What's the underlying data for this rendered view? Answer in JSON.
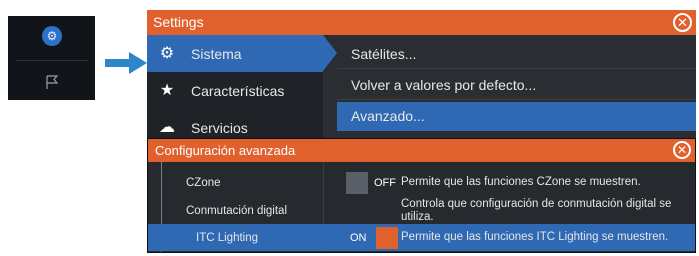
{
  "colors": {
    "accent": "#e0612d",
    "selection": "#2f69b3",
    "panel": "#2a2d31"
  },
  "device": {
    "icons": [
      "gear-icon",
      "flag-icon"
    ]
  },
  "settings": {
    "title": "Settings",
    "menu": [
      {
        "label": "Sistema",
        "icon": "gear-icon"
      },
      {
        "label": "Características",
        "icon": "star-icon"
      },
      {
        "label": "Servicios",
        "icon": "cloud-icon"
      }
    ],
    "options": [
      "Satélites...",
      "Volver a valores por defecto...",
      "Avanzado..."
    ]
  },
  "advanced": {
    "title": "Configuración avanzada",
    "rows": [
      {
        "name": "CZone",
        "toggle": "OFF",
        "desc": "Permite que las funciones CZone se muestren."
      },
      {
        "name": "Conmutación digital",
        "desc": "Controla que configuración de conmutación digital se utiliza."
      },
      {
        "name": "ITC Lighting",
        "toggle": "ON",
        "desc": "Permite que las funciones ITC Lighting se muestren."
      }
    ]
  }
}
